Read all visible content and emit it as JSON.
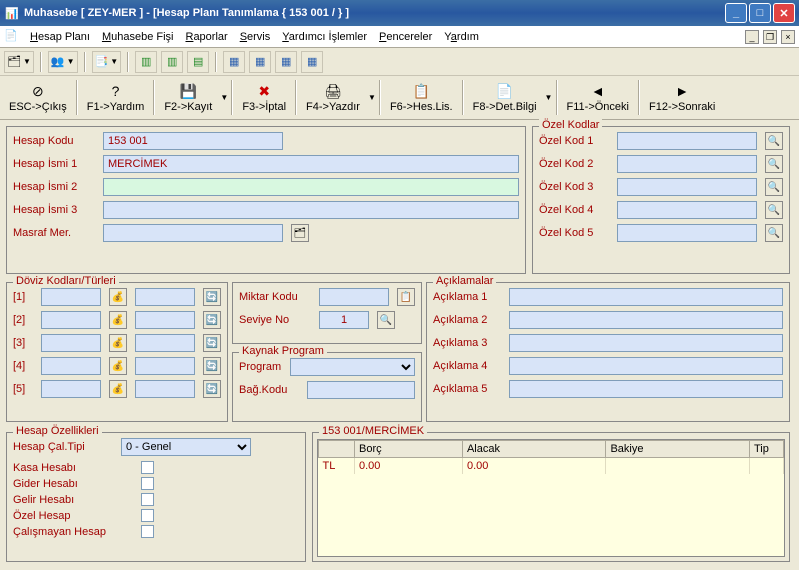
{
  "window": {
    "title": "Muhasebe [ ZEY-MER ]  - [Hesap Planı Tanımlama { 153 001 /  } ]"
  },
  "menu": {
    "items": [
      "Hesap Planı",
      "Muhasebe Fişi",
      "Raporlar",
      "Servis",
      "Yardımcı İşlemler",
      "Pencereler",
      "Yardım"
    ]
  },
  "toolbar2": [
    {
      "label": "ESC->Çıkış",
      "icon": "⊘"
    },
    {
      "label": "F1->Yardım",
      "icon": "?"
    },
    {
      "label": "F2->Kayıt",
      "icon": "💾"
    },
    {
      "label": "F3->İptal",
      "icon": "✖"
    },
    {
      "label": "F4->Yazdır",
      "icon": "🖨"
    },
    {
      "label": "F6->Hes.Lis.",
      "icon": "📋"
    },
    {
      "label": "F8->Det.Bilgi",
      "icon": "📄"
    },
    {
      "label": "F11->Önceki",
      "icon": "◄"
    },
    {
      "label": "F12->Sonraki",
      "icon": "►"
    }
  ],
  "main": {
    "hesap_kodu_l": "Hesap Kodu",
    "hesap_kodu": "153 001",
    "hesap_ismi1_l": "Hesap İsmi 1",
    "hesap_ismi1": "MERCİMEK",
    "hesap_ismi2_l": "Hesap İsmi 2",
    "hesap_ismi2": "",
    "hesap_ismi3_l": "Hesap İsmi 3",
    "hesap_ismi3": "",
    "masraf_l": "Masraf Mer.",
    "masraf": ""
  },
  "ozel": {
    "legend": "Özel Kodlar",
    "labels": [
      "Özel Kod 1",
      "Özel Kod 2",
      "Özel Kod 3",
      "Özel Kod 4",
      "Özel Kod 5"
    ]
  },
  "doviz": {
    "legend": "Döviz Kodları/Türleri",
    "labels": [
      "[1]",
      "[2]",
      "[3]",
      "[4]",
      "[5]"
    ]
  },
  "miktar": {
    "miktar_l": "Miktar Kodu",
    "seviye_l": "Seviye No",
    "seviye": "1"
  },
  "kaynak": {
    "legend": "Kaynak Program",
    "program_l": "Program",
    "bag_l": "Bağ.Kodu"
  },
  "aciklama": {
    "legend": "Açıklamalar",
    "labels": [
      "Açıklama 1",
      "Açıklama 2",
      "Açıklama 3",
      "Açıklama 4",
      "Açıklama 5"
    ]
  },
  "ozellik": {
    "legend": "Hesap Özellikleri",
    "caltipi_l": "Hesap Çal.Tipi",
    "caltipi": "0 - Genel",
    "labels": [
      "Kasa Hesabı",
      "Gider Hesabı",
      "Gelir Hesabı",
      "Özel Hesap",
      "Çalışmayan Hesap"
    ]
  },
  "grid": {
    "title": "153 001/MERCİMEK",
    "cols": [
      "",
      "Borç",
      "Alacak",
      "Bakiye",
      "Tip"
    ],
    "row": [
      "TL",
      "0.00",
      "0.00",
      "",
      ""
    ]
  }
}
